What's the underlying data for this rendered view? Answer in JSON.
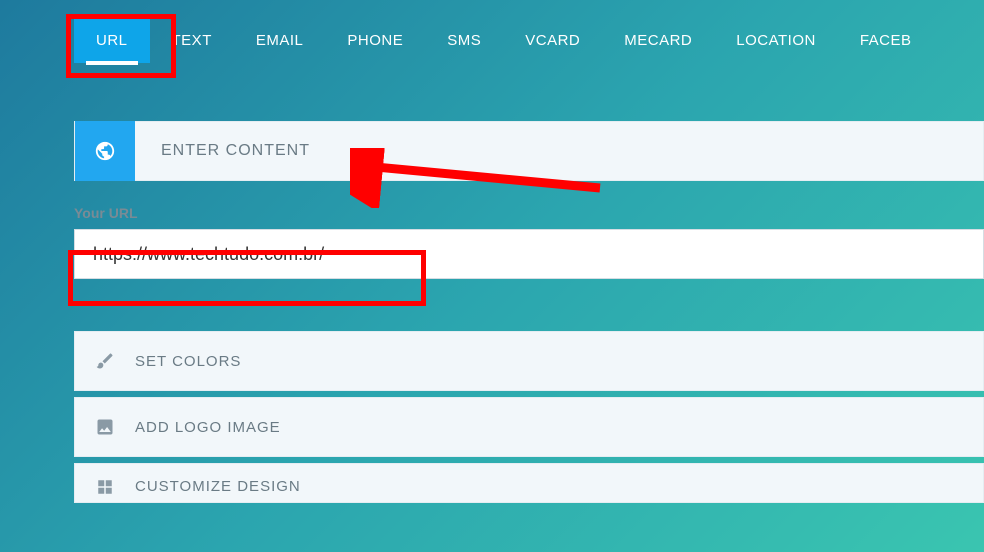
{
  "tabs": [
    {
      "label": "URL",
      "active": true
    },
    {
      "label": "TEXT",
      "active": false
    },
    {
      "label": "EMAIL",
      "active": false
    },
    {
      "label": "PHONE",
      "active": false
    },
    {
      "label": "SMS",
      "active": false
    },
    {
      "label": "VCARD",
      "active": false
    },
    {
      "label": "MECARD",
      "active": false
    },
    {
      "label": "LOCATION",
      "active": false
    },
    {
      "label": "FACEB",
      "active": false
    }
  ],
  "step_header": {
    "title": "ENTER CONTENT",
    "icon": "globe-icon"
  },
  "form": {
    "url_label": "Your URL",
    "url_value": "https://www.techtudo.com.br/"
  },
  "options": [
    {
      "icon": "brush-icon",
      "label": "SET COLORS"
    },
    {
      "icon": "image-icon",
      "label": "ADD LOGO IMAGE"
    },
    {
      "icon": "grid-icon",
      "label": "CUSTOMIZE DESIGN"
    }
  ],
  "annotations": {
    "highlight_tab": true,
    "highlight_input": true,
    "arrow_to_header": true,
    "color": "#ff0000"
  }
}
